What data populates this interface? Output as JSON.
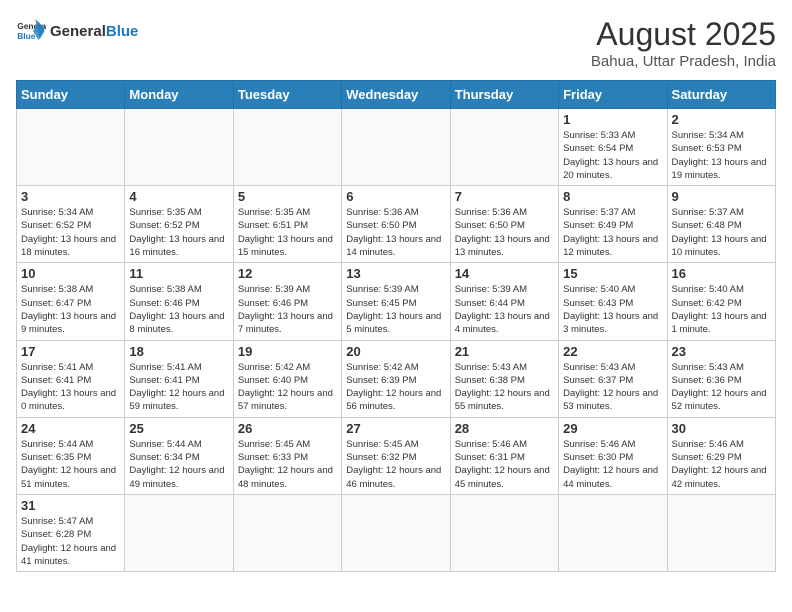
{
  "header": {
    "logo_general": "General",
    "logo_blue": "Blue",
    "month_year": "August 2025",
    "location": "Bahua, Uttar Pradesh, India"
  },
  "weekdays": [
    "Sunday",
    "Monday",
    "Tuesday",
    "Wednesday",
    "Thursday",
    "Friday",
    "Saturday"
  ],
  "weeks": [
    [
      {
        "day": "",
        "info": ""
      },
      {
        "day": "",
        "info": ""
      },
      {
        "day": "",
        "info": ""
      },
      {
        "day": "",
        "info": ""
      },
      {
        "day": "",
        "info": ""
      },
      {
        "day": "1",
        "info": "Sunrise: 5:33 AM\nSunset: 6:54 PM\nDaylight: 13 hours and 20 minutes."
      },
      {
        "day": "2",
        "info": "Sunrise: 5:34 AM\nSunset: 6:53 PM\nDaylight: 13 hours and 19 minutes."
      }
    ],
    [
      {
        "day": "3",
        "info": "Sunrise: 5:34 AM\nSunset: 6:52 PM\nDaylight: 13 hours and 18 minutes."
      },
      {
        "day": "4",
        "info": "Sunrise: 5:35 AM\nSunset: 6:52 PM\nDaylight: 13 hours and 16 minutes."
      },
      {
        "day": "5",
        "info": "Sunrise: 5:35 AM\nSunset: 6:51 PM\nDaylight: 13 hours and 15 minutes."
      },
      {
        "day": "6",
        "info": "Sunrise: 5:36 AM\nSunset: 6:50 PM\nDaylight: 13 hours and 14 minutes."
      },
      {
        "day": "7",
        "info": "Sunrise: 5:36 AM\nSunset: 6:50 PM\nDaylight: 13 hours and 13 minutes."
      },
      {
        "day": "8",
        "info": "Sunrise: 5:37 AM\nSunset: 6:49 PM\nDaylight: 13 hours and 12 minutes."
      },
      {
        "day": "9",
        "info": "Sunrise: 5:37 AM\nSunset: 6:48 PM\nDaylight: 13 hours and 10 minutes."
      }
    ],
    [
      {
        "day": "10",
        "info": "Sunrise: 5:38 AM\nSunset: 6:47 PM\nDaylight: 13 hours and 9 minutes."
      },
      {
        "day": "11",
        "info": "Sunrise: 5:38 AM\nSunset: 6:46 PM\nDaylight: 13 hours and 8 minutes."
      },
      {
        "day": "12",
        "info": "Sunrise: 5:39 AM\nSunset: 6:46 PM\nDaylight: 13 hours and 7 minutes."
      },
      {
        "day": "13",
        "info": "Sunrise: 5:39 AM\nSunset: 6:45 PM\nDaylight: 13 hours and 5 minutes."
      },
      {
        "day": "14",
        "info": "Sunrise: 5:39 AM\nSunset: 6:44 PM\nDaylight: 13 hours and 4 minutes."
      },
      {
        "day": "15",
        "info": "Sunrise: 5:40 AM\nSunset: 6:43 PM\nDaylight: 13 hours and 3 minutes."
      },
      {
        "day": "16",
        "info": "Sunrise: 5:40 AM\nSunset: 6:42 PM\nDaylight: 13 hours and 1 minute."
      }
    ],
    [
      {
        "day": "17",
        "info": "Sunrise: 5:41 AM\nSunset: 6:41 PM\nDaylight: 13 hours and 0 minutes."
      },
      {
        "day": "18",
        "info": "Sunrise: 5:41 AM\nSunset: 6:41 PM\nDaylight: 12 hours and 59 minutes."
      },
      {
        "day": "19",
        "info": "Sunrise: 5:42 AM\nSunset: 6:40 PM\nDaylight: 12 hours and 57 minutes."
      },
      {
        "day": "20",
        "info": "Sunrise: 5:42 AM\nSunset: 6:39 PM\nDaylight: 12 hours and 56 minutes."
      },
      {
        "day": "21",
        "info": "Sunrise: 5:43 AM\nSunset: 6:38 PM\nDaylight: 12 hours and 55 minutes."
      },
      {
        "day": "22",
        "info": "Sunrise: 5:43 AM\nSunset: 6:37 PM\nDaylight: 12 hours and 53 minutes."
      },
      {
        "day": "23",
        "info": "Sunrise: 5:43 AM\nSunset: 6:36 PM\nDaylight: 12 hours and 52 minutes."
      }
    ],
    [
      {
        "day": "24",
        "info": "Sunrise: 5:44 AM\nSunset: 6:35 PM\nDaylight: 12 hours and 51 minutes."
      },
      {
        "day": "25",
        "info": "Sunrise: 5:44 AM\nSunset: 6:34 PM\nDaylight: 12 hours and 49 minutes."
      },
      {
        "day": "26",
        "info": "Sunrise: 5:45 AM\nSunset: 6:33 PM\nDaylight: 12 hours and 48 minutes."
      },
      {
        "day": "27",
        "info": "Sunrise: 5:45 AM\nSunset: 6:32 PM\nDaylight: 12 hours and 46 minutes."
      },
      {
        "day": "28",
        "info": "Sunrise: 5:46 AM\nSunset: 6:31 PM\nDaylight: 12 hours and 45 minutes."
      },
      {
        "day": "29",
        "info": "Sunrise: 5:46 AM\nSunset: 6:30 PM\nDaylight: 12 hours and 44 minutes."
      },
      {
        "day": "30",
        "info": "Sunrise: 5:46 AM\nSunset: 6:29 PM\nDaylight: 12 hours and 42 minutes."
      }
    ],
    [
      {
        "day": "31",
        "info": "Sunrise: 5:47 AM\nSunset: 6:28 PM\nDaylight: 12 hours and 41 minutes."
      },
      {
        "day": "",
        "info": ""
      },
      {
        "day": "",
        "info": ""
      },
      {
        "day": "",
        "info": ""
      },
      {
        "day": "",
        "info": ""
      },
      {
        "day": "",
        "info": ""
      },
      {
        "day": "",
        "info": ""
      }
    ]
  ]
}
